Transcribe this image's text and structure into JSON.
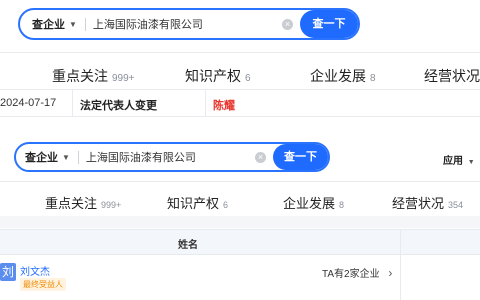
{
  "top": {
    "search": {
      "scope": "查企业",
      "query": "上海国际油漆有限公司",
      "button": "查一下"
    },
    "tabs": [
      {
        "label": "重点关注",
        "count": "999+"
      },
      {
        "label": "知识产权",
        "count": "6"
      },
      {
        "label": "企业发展",
        "count": "8"
      },
      {
        "label": "经营状况",
        "count": ""
      }
    ],
    "change_row": {
      "date": "2024-07-17",
      "item": "法定代表人变更",
      "value": "陈耀"
    }
  },
  "bottom": {
    "search": {
      "scope": "查企业",
      "query": "上海国际油漆有限公司",
      "button": "查一下"
    },
    "apps_label": "应用",
    "tabs": [
      {
        "label": "重点关注",
        "count": "999+"
      },
      {
        "label": "知识产权",
        "count": "6"
      },
      {
        "label": "企业发展",
        "count": "8"
      },
      {
        "label": "经营状况",
        "count": "354"
      }
    ],
    "table": {
      "header": "姓名",
      "rows": [
        {
          "avatar": "刘",
          "name": "刘文杰",
          "badge": "最终受益人",
          "companies_link": "TA有2家企业"
        }
      ]
    }
  },
  "icons": {
    "dropdown": "chevron-down-icon",
    "clear": "clear-icon",
    "link_arrow": "chevron-right-icon"
  },
  "colors": {
    "accent": "#1f6bff",
    "alert_red": "#e8352d",
    "badge_orange": "#f08a00",
    "badge_bg": "#fff3e0",
    "table_header_bg": "#f3f6fa"
  }
}
